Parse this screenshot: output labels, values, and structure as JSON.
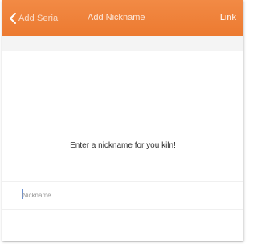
{
  "nav": {
    "back_label": "Add Serial",
    "title": "Add Nickname",
    "link_label": "Link",
    "back_icon": "chevron-left-icon",
    "bar_color": "#ee7d34"
  },
  "main": {
    "prompt": "Enter a nickname for you kiln!",
    "nickname": {
      "value": "",
      "placeholder": "Nickname"
    }
  }
}
